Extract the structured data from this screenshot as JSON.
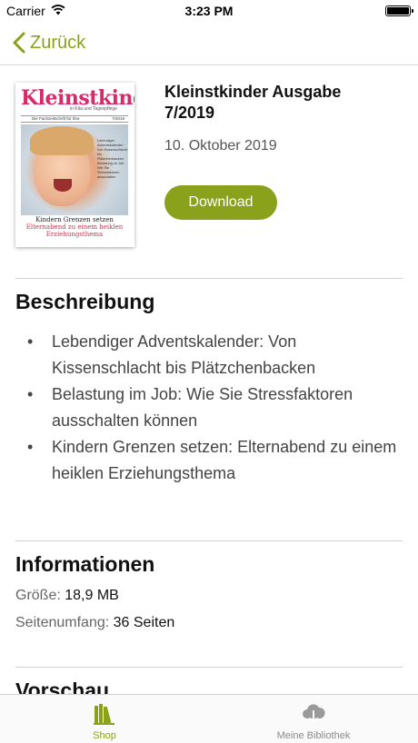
{
  "status_bar": {
    "carrier": "Carrier",
    "time": "3:23 PM"
  },
  "nav": {
    "back_label": "Zurück"
  },
  "issue": {
    "title": "Kleinstkinder Ausgabe 7/2019",
    "date": "10. Oktober 2019",
    "download_label": "Download",
    "cover": {
      "logo": "Kleinstkinder",
      "subline": "in Kita und Tagespflege",
      "bar_text": "Die Fachzeitschrift für Ihre",
      "issue_no": "7/2019",
      "side_text": "Lebendiger Adventskalender · Von Kissenschlacht bis Plätzchenbacken · Belastung im Job · Wie Sie Stressfaktoren ausschalten",
      "headline": "Kindern Grenzen setzen",
      "headline_sub": "Elternabend zu einem heiklen Erziehungsthema"
    }
  },
  "description": {
    "heading": "Beschreibung",
    "items": [
      "Lebendiger Adventskalender: Von Kissenschlacht bis Plätzchenbacken",
      "Belastung im Job: Wie Sie Stressfaktoren ausschalten können",
      "Kindern Grenzen setzen: Elternabend zu einem heiklen Erziehungsthema"
    ]
  },
  "information": {
    "heading": "Informationen",
    "size_label": "Größe:",
    "size_value": "18,9 MB",
    "pages_label": "Seitenumfang:",
    "pages_value": "36 Seiten"
  },
  "preview": {
    "heading": "Vorschau"
  },
  "tab_bar": {
    "tabs": [
      {
        "label": "Shop",
        "icon": "books-icon",
        "active": true
      },
      {
        "label": "Meine Bibliothek",
        "icon": "cloud-download-icon",
        "active": false
      }
    ]
  },
  "colors": {
    "accent": "#8aa11c",
    "inactive": "#8a8a8a"
  }
}
